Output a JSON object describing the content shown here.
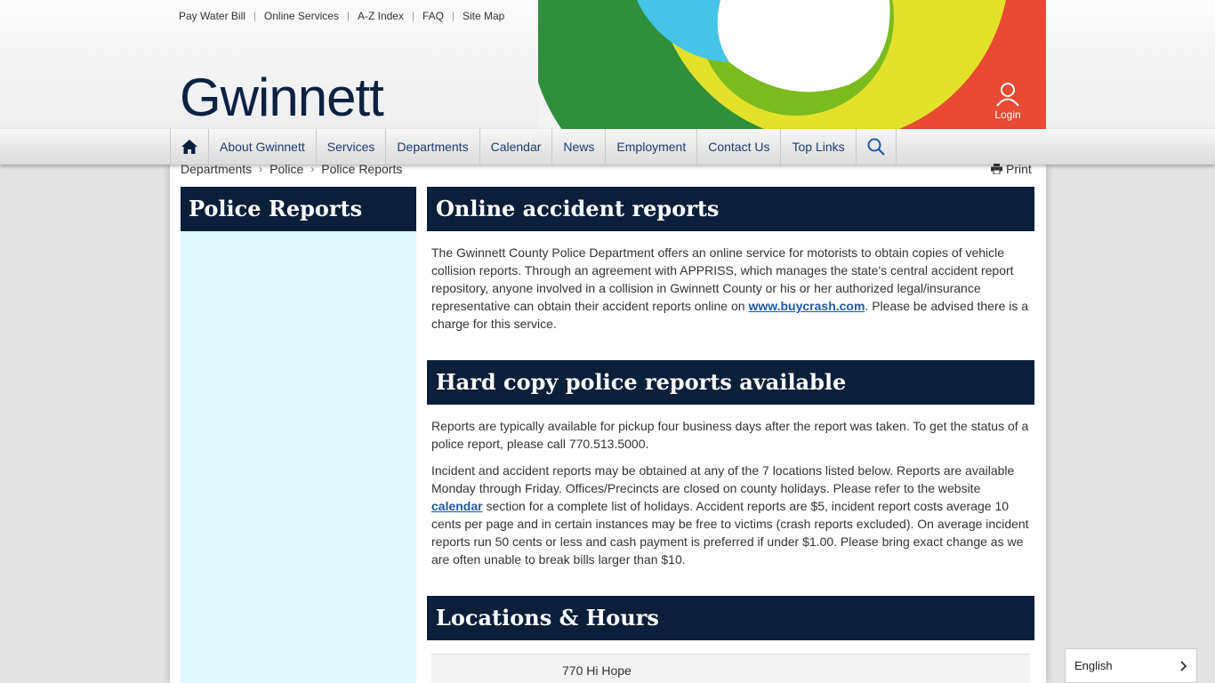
{
  "utility_links": [
    "Pay Water Bill",
    "Online Services",
    "A-Z Index",
    "FAQ",
    "Site Map"
  ],
  "logo": "Gwinnett",
  "login_label": "Login",
  "nav": {
    "items": [
      "About Gwinnett",
      "Services",
      "Departments",
      "Calendar",
      "News",
      "Employment",
      "Contact Us",
      "Top Links"
    ]
  },
  "breadcrumb": [
    "Departments",
    "Police",
    "Police Reports"
  ],
  "print_label": "Print",
  "sidebar": {
    "title": "Police Reports"
  },
  "sections": {
    "online": {
      "title": "Online accident reports",
      "text_before": "The Gwinnett County Police Department offers an online service for motorists to obtain copies of vehicle collision reports. Through an agreement with  APPRISS, which manages the state's central accident report repository, anyone involved in a collision in Gwinnett County or his or her authorized legal/insurance representative can obtain their accident reports online on ",
      "link": "www.buycrash.com",
      "text_after": ". Please be advised there is a charge for this service."
    },
    "hardcopy": {
      "title": "Hard copy police reports available",
      "para1": "Reports are typically available for pickup four business days after the report was taken. To get the status of a police report, please call 770.513.5000.",
      "para2_before": "Incident and accident reports may be obtained at any of the 7 locations listed below.   Reports are available Monday through Friday. Offices/Precincts are closed on county holidays.  Please refer to the website ",
      "para2_link": "calendar",
      "para2_after": " section for a complete list of holidays.  Accident reports are $5, incident report costs average 10 cents per page and in certain instances may be free to victims (crash reports excluded).  On average incident reports run 50 cents or less and cash payment is preferred if under $1.00.   Please bring exact change as we are often unable to break bills larger than $10."
    },
    "locations": {
      "title": "Locations & Hours",
      "first_address": "770 Hi Hope"
    }
  },
  "language": {
    "selected": "English"
  },
  "colors": {
    "navy": "#0c1f3a",
    "sidebar_bg": "#dff8fd",
    "link": "#1d5aa8"
  }
}
